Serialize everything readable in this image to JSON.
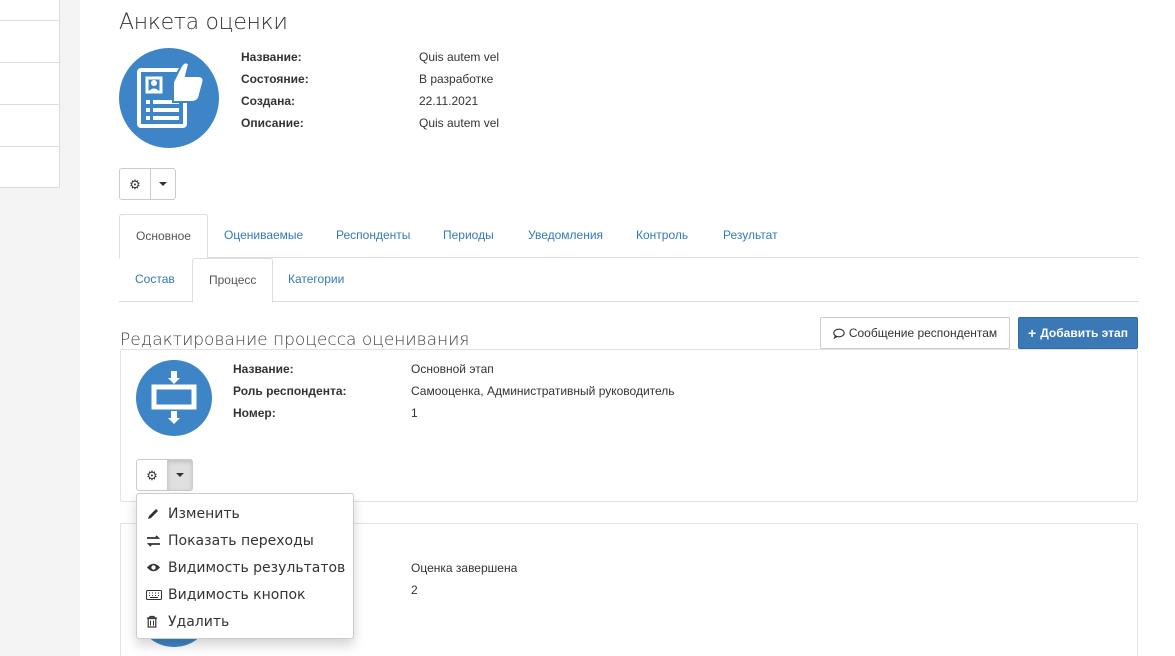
{
  "page": {
    "title": "Анкета оценки"
  },
  "survey": {
    "fields": [
      {
        "label": "Название:",
        "value": "Quis autem vel"
      },
      {
        "label": "Состояние:",
        "value": "В разработке"
      },
      {
        "label": "Создана:",
        "value": "22.11.2021"
      },
      {
        "label": "Описание:",
        "value": "Quis autem vel"
      }
    ]
  },
  "main_tabs": [
    {
      "label": "Основное",
      "active": true
    },
    {
      "label": "Оцениваемые"
    },
    {
      "label": "Респонденты"
    },
    {
      "label": "Периоды"
    },
    {
      "label": "Уведомления"
    },
    {
      "label": "Контроль"
    },
    {
      "label": "Результат"
    }
  ],
  "sub_tabs": [
    {
      "label": "Состав"
    },
    {
      "label": "Процесс",
      "active": true
    },
    {
      "label": "Категории"
    }
  ],
  "process": {
    "title": "Редактирование процесса оценивания",
    "message_button": "Сообщение респондентам",
    "add_button": "Добавить этап"
  },
  "stage1": {
    "fields": [
      {
        "label": "Название:",
        "value": "Основной этап"
      },
      {
        "label": "Роль респондента:",
        "value": "Самооценка, Административный руководитель"
      },
      {
        "label": "Номер:",
        "value": "1"
      }
    ]
  },
  "stage2": {
    "values": [
      "Оценка завершена",
      "2"
    ]
  },
  "menu": {
    "items": [
      {
        "label": "Изменить",
        "icon": "pencil-icon"
      },
      {
        "label": "Показать переходы",
        "icon": "exchange-icon"
      },
      {
        "label": "Видимость результатов",
        "icon": "eye-icon"
      },
      {
        "label": "Видимость кнопок",
        "icon": "keyboard-icon"
      },
      {
        "label": "Удалить",
        "icon": "trash-icon"
      }
    ]
  },
  "colors": {
    "accent": "#3d85c6",
    "link": "#337ab7",
    "primary_button": "#3a78b6"
  }
}
